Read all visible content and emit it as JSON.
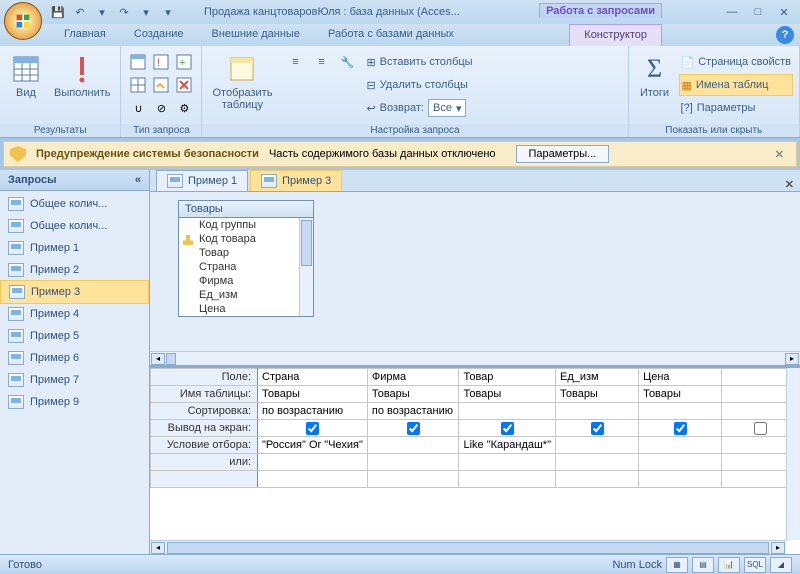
{
  "title": "Продажа канцтоваровЮля : база данных (Acces...",
  "context_tab_group": "Работа с запросами",
  "tabs": {
    "home": "Главная",
    "create": "Создание",
    "external": "Внешние данные",
    "dbtools": "Работа с базами данных",
    "design": "Конструктор"
  },
  "ribbon": {
    "results": {
      "view": "Вид",
      "run": "Выполнить",
      "label": "Результаты"
    },
    "type": {
      "label": "Тип запроса"
    },
    "setup": {
      "showtable": "Отобразить\nтаблицу",
      "insert_cols": "Вставить столбцы",
      "delete_cols": "Удалить столбцы",
      "return": "Возврат:",
      "return_val": "Все",
      "label": "Настройка запроса"
    },
    "showhide": {
      "totals": "Итоги",
      "props": "Страница свойств",
      "tnames": "Имена таблиц",
      "params": "Параметры",
      "label": "Показать или скрыть"
    }
  },
  "security": {
    "title": "Предупреждение системы безопасности",
    "msg": "Часть содержимого базы данных отключено",
    "options": "Параметры..."
  },
  "nav": {
    "header": "Запросы",
    "items": [
      "Общее колич...",
      "Общее колич...",
      "Пример 1",
      "Пример 2",
      "Пример 3",
      "Пример 4",
      "Пример 5",
      "Пример 6",
      "Пример 7",
      "Пример 9"
    ],
    "selected": 4
  },
  "doc": {
    "tabs": [
      {
        "label": "Пример 1"
      },
      {
        "label": "Пример 3"
      }
    ],
    "active": 1,
    "table": {
      "name": "Товары",
      "fields": [
        "Код группы",
        "Код товара",
        "Товар",
        "Страна",
        "Фирма",
        "Ед_изм",
        "Цена"
      ],
      "key_index": 1
    },
    "grid": {
      "rowlabels": {
        "field": "Поле:",
        "table": "Имя таблицы:",
        "sort": "Сортировка:",
        "show": "Вывод на экран:",
        "criteria": "Условие отбора:",
        "or": "или:"
      },
      "cols": [
        {
          "field": "Страна",
          "table": "Товары",
          "sort": "по возрастанию",
          "show": true,
          "criteria": "\"Россия\" Or \"Чехия\""
        },
        {
          "field": "Фирма",
          "table": "Товары",
          "sort": "по возрастанию",
          "show": true,
          "criteria": ""
        },
        {
          "field": "Товар",
          "table": "Товары",
          "sort": "",
          "show": true,
          "criteria": "Like \"Карандаш*\""
        },
        {
          "field": "Ед_изм",
          "table": "Товары",
          "sort": "",
          "show": true,
          "criteria": ""
        },
        {
          "field": "Цена",
          "table": "Товары",
          "sort": "",
          "show": true,
          "criteria": ""
        },
        {
          "field": "",
          "table": "",
          "sort": "",
          "show": false,
          "criteria": ""
        }
      ]
    }
  },
  "status": {
    "ready": "Готово",
    "numlock": "Num Lock",
    "sql": "SQL"
  }
}
